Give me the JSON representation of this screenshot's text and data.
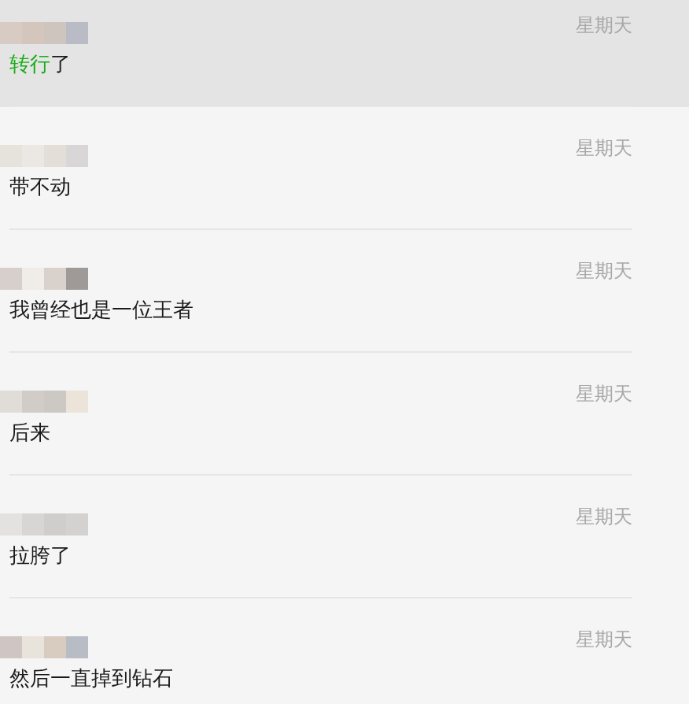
{
  "chats": [
    {
      "selected": true,
      "time": "星期天",
      "message": [
        {
          "text": "转行",
          "kind": "highlight"
        },
        {
          "text": "了",
          "kind": "plain"
        }
      ]
    },
    {
      "selected": false,
      "time": "星期天",
      "message": [
        {
          "text": "带不动",
          "kind": "plain"
        }
      ]
    },
    {
      "selected": false,
      "time": "星期天",
      "message": [
        {
          "text": "我曾经也是一位王者",
          "kind": "plain"
        }
      ]
    },
    {
      "selected": false,
      "time": "星期天",
      "message": [
        {
          "text": "后来",
          "kind": "plain"
        }
      ]
    },
    {
      "selected": false,
      "time": "星期天",
      "message": [
        {
          "text": "拉胯了",
          "kind": "plain"
        }
      ]
    },
    {
      "selected": false,
      "time": "星期天",
      "message": [
        {
          "text": "然后一直掉到钻石",
          "kind": "plain"
        }
      ]
    }
  ]
}
